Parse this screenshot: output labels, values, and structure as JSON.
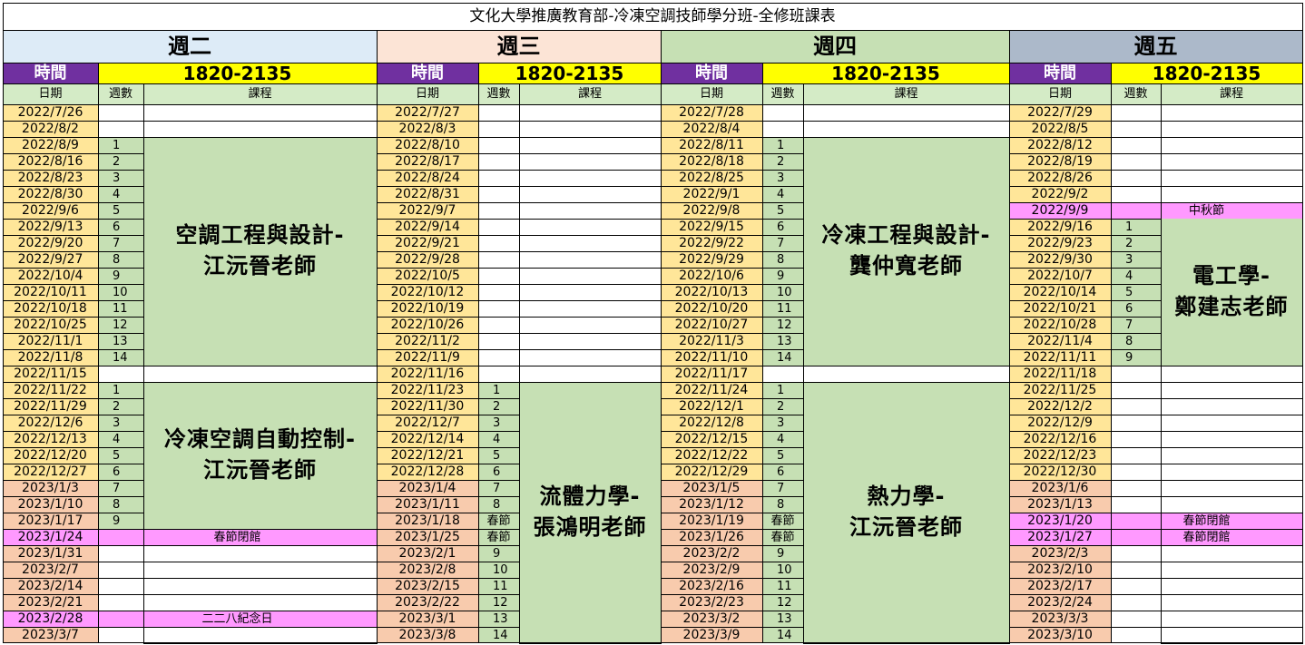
{
  "title": "文化大學推廣教育部-冷凍空調技師學分班-全修班課表",
  "labels": {
    "time": "時間",
    "time_value": "1820-2135",
    "col_date": "日期",
    "col_week": "週數",
    "col_course": "課程"
  },
  "colors": {
    "tue": "#ddebf7",
    "wed": "#fce4d6",
    "thu": "#c6e0b4",
    "fri": "#acb9ca",
    "date_summer": "#ffe699",
    "date_winter": "#f8cbad",
    "course": "#c6e0b4",
    "holiday": "#ff99ff",
    "time_label": "#7030a0",
    "time_value": "#ffff00",
    "header_row": "#d4ebc6"
  },
  "days": [
    {
      "name": "週二",
      "dates": [
        "2022/7/26",
        "2022/8/2",
        "2022/8/9",
        "2022/8/16",
        "2022/8/23",
        "2022/8/30",
        "2022/9/6",
        "2022/9/13",
        "2022/9/20",
        "2022/9/27",
        "2022/10/4",
        "2022/10/11",
        "2022/10/18",
        "2022/10/25",
        "2022/11/1",
        "2022/11/8",
        "2022/11/15",
        "2022/11/22",
        "2022/11/29",
        "2022/12/6",
        "2022/12/13",
        "2022/12/20",
        "2022/12/27",
        "2023/1/3",
        "2023/1/10",
        "2023/1/17",
        "2023/1/24",
        "2023/1/31",
        "2023/2/7",
        "2023/2/14",
        "2023/2/21",
        "2023/2/28",
        "2023/3/7"
      ],
      "weeks": [
        "",
        "",
        "1",
        "2",
        "3",
        "4",
        "5",
        "6",
        "7",
        "8",
        "9",
        "10",
        "11",
        "12",
        "13",
        "14",
        "",
        "1",
        "2",
        "3",
        "4",
        "5",
        "6",
        "7",
        "8",
        "9",
        "",
        "",
        "",
        "",
        "",
        "",
        ""
      ],
      "courses": [
        {
          "start": 2,
          "end": 15,
          "text": "空調工程與設計-\n江沅晉老師"
        },
        {
          "start": 17,
          "end": 25,
          "text": "冷凍空調自動控制-\n江沅晉老師"
        }
      ],
      "holidays": [
        {
          "row": 26,
          "text": "春節閉館"
        },
        {
          "row": 31,
          "text": "二二八紀念日"
        }
      ]
    },
    {
      "name": "週三",
      "dates": [
        "2022/7/27",
        "2022/8/3",
        "2022/8/10",
        "2022/8/17",
        "2022/8/24",
        "2022/8/31",
        "2022/9/7",
        "2022/9/14",
        "2022/9/21",
        "2022/9/28",
        "2022/10/5",
        "2022/10/12",
        "2022/10/19",
        "2022/10/26",
        "2022/11/2",
        "2022/11/9",
        "2022/11/16",
        "2022/11/23",
        "2022/11/30",
        "2022/12/7",
        "2022/12/14",
        "2022/12/21",
        "2022/12/28",
        "2023/1/4",
        "2023/1/11",
        "2023/1/18",
        "2023/1/25",
        "2023/2/1",
        "2023/2/8",
        "2023/2/15",
        "2023/2/22",
        "2023/3/1",
        "2023/3/8"
      ],
      "weeks": [
        "",
        "",
        "",
        "",
        "",
        "",
        "",
        "",
        "",
        "",
        "",
        "",
        "",
        "",
        "",
        "",
        "",
        "1",
        "2",
        "3",
        "4",
        "5",
        "6",
        "7",
        "8",
        "春節",
        "春節",
        "9",
        "10",
        "11",
        "12",
        "13",
        "14"
      ],
      "courses": [
        {
          "start": 17,
          "end": 32,
          "text": "流體力學-\n張鴻明老師"
        }
      ],
      "holidays": []
    },
    {
      "name": "週四",
      "dates": [
        "2022/7/28",
        "2022/8/4",
        "2022/8/11",
        "2022/8/18",
        "2022/8/25",
        "2022/9/1",
        "2022/9/8",
        "2022/9/15",
        "2022/9/22",
        "2022/9/29",
        "2022/10/6",
        "2022/10/13",
        "2022/10/20",
        "2022/10/27",
        "2022/11/3",
        "2022/11/10",
        "2022/11/17",
        "2022/11/24",
        "2022/12/1",
        "2022/12/8",
        "2022/12/15",
        "2022/12/22",
        "2022/12/29",
        "2023/1/5",
        "2023/1/12",
        "2023/1/19",
        "2023/1/26",
        "2023/2/2",
        "2023/2/9",
        "2023/2/16",
        "2023/2/23",
        "2023/3/2",
        "2023/3/9"
      ],
      "weeks": [
        "",
        "",
        "1",
        "2",
        "3",
        "4",
        "5",
        "6",
        "7",
        "8",
        "9",
        "10",
        "11",
        "12",
        "13",
        "14",
        "",
        "1",
        "2",
        "3",
        "4",
        "5",
        "6",
        "7",
        "8",
        "春節",
        "春節",
        "9",
        "10",
        "11",
        "12",
        "13",
        "14"
      ],
      "courses": [
        {
          "start": 2,
          "end": 15,
          "text": "冷凍工程與設計-\n龔仲寬老師"
        },
        {
          "start": 17,
          "end": 32,
          "text": "熱力學-\n江沅晉老師"
        }
      ],
      "holidays": []
    },
    {
      "name": "週五",
      "dates": [
        "2022/7/29",
        "2022/8/5",
        "2022/8/12",
        "2022/8/19",
        "2022/8/26",
        "2022/9/2",
        "2022/9/9",
        "2022/9/16",
        "2022/9/23",
        "2022/9/30",
        "2022/10/7",
        "2022/10/14",
        "2022/10/21",
        "2022/10/28",
        "2022/11/4",
        "2022/11/11",
        "2022/11/18",
        "2022/11/25",
        "2022/12/2",
        "2022/12/9",
        "2022/12/16",
        "2022/12/23",
        "2022/12/30",
        "2023/1/6",
        "2023/1/13",
        "2023/1/20",
        "2023/1/27",
        "2023/2/3",
        "2023/2/10",
        "2023/2/17",
        "2023/2/24",
        "2023/3/3",
        "2023/3/10"
      ],
      "weeks": [
        "",
        "",
        "",
        "",
        "",
        "",
        "",
        "1",
        "2",
        "3",
        "4",
        "5",
        "6",
        "7",
        "8",
        "9",
        "",
        "",
        "",
        "",
        "",
        "",
        "",
        "",
        "",
        "",
        "",
        "",
        "",
        "",
        "",
        "",
        ""
      ],
      "courses": [
        {
          "start": 7,
          "end": 15,
          "text": "電工學-\n鄭建志老師"
        }
      ],
      "holidays": [
        {
          "row": 6,
          "text": "中秋節"
        },
        {
          "row": 25,
          "text": "春節閉館"
        },
        {
          "row": 26,
          "text": "春節閉館"
        }
      ]
    }
  ]
}
